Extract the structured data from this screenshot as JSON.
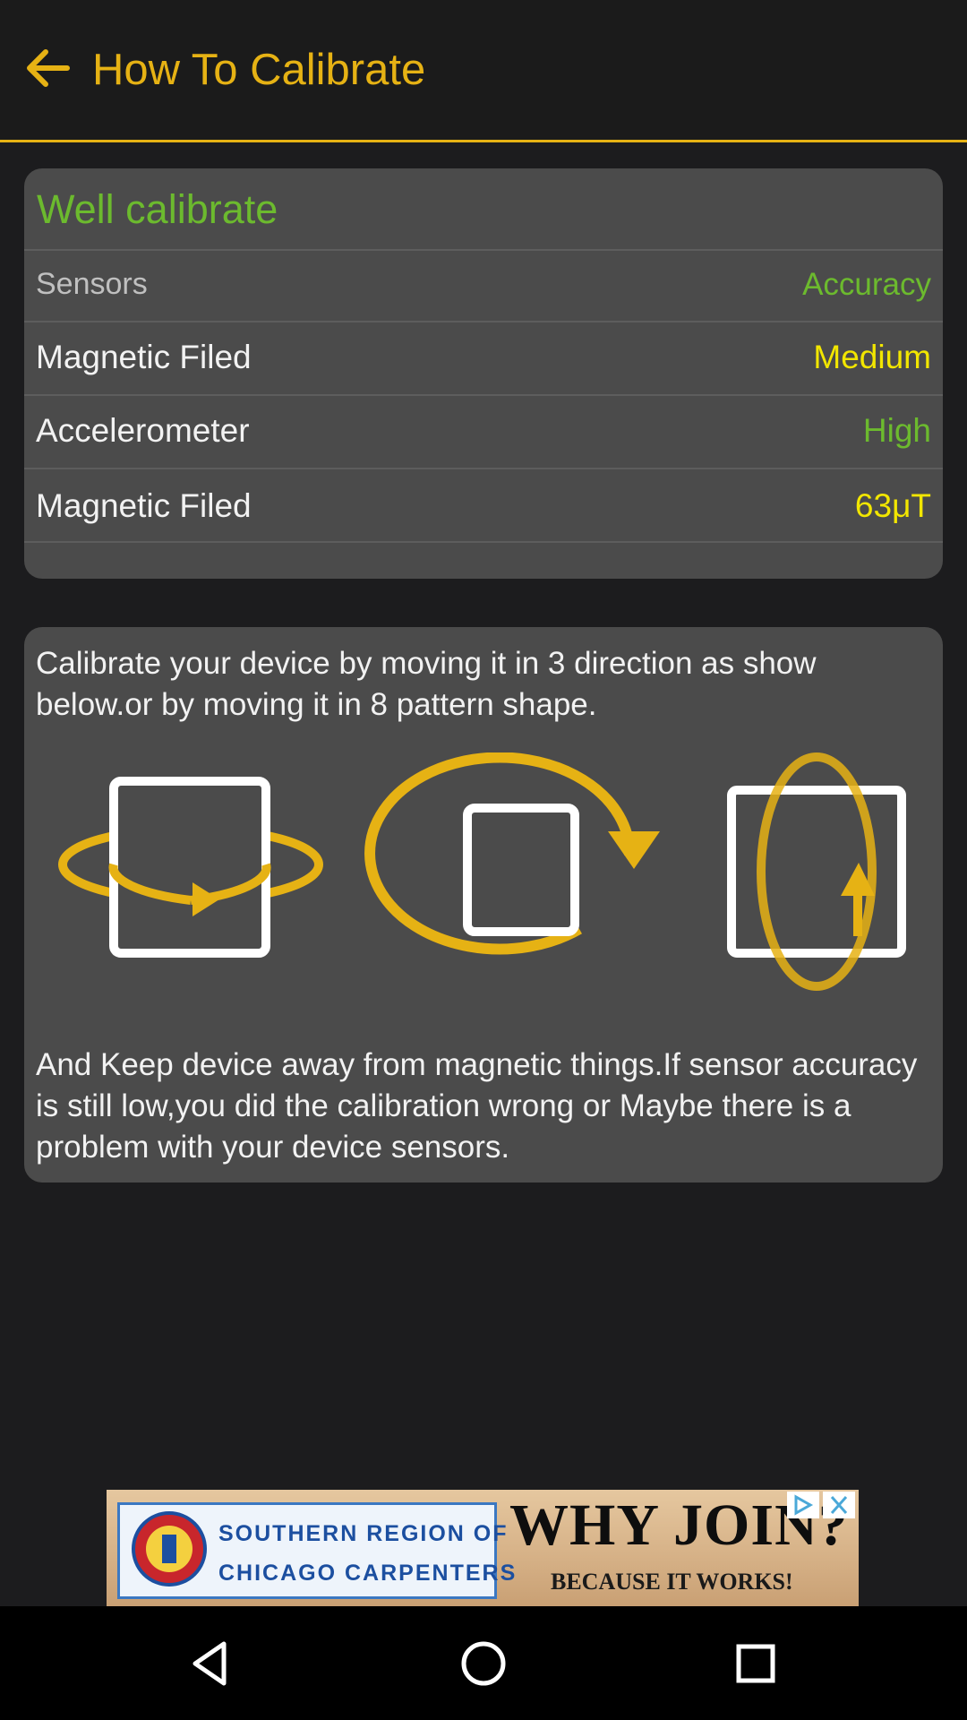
{
  "header": {
    "title": "How To Calibrate",
    "back_icon": "arrow-left-icon",
    "accent_color": "#e6b214"
  },
  "status_card": {
    "title": "Well calibrate",
    "columns": {
      "left": "Sensors",
      "right": "Accuracy"
    },
    "rows": [
      {
        "label": "Magnetic Filed",
        "value": "Medium",
        "value_color": "#f2e600"
      },
      {
        "label": "Accelerometer",
        "value": "High",
        "value_color": "#6cba2e"
      },
      {
        "label": "Magnetic Filed",
        "value": "63μT",
        "value_color": "#f2e600"
      }
    ]
  },
  "instructions_card": {
    "intro": "Calibrate your device by moving it in 3 direction as show below.or by moving it in 8 pattern shape.",
    "illustrations": [
      "rotate-horizontal-icon",
      "rotate-flat-icon",
      "rotate-vertical-icon"
    ],
    "note": "And Keep device away from magnetic things.If sensor accuracy is still low,you did the calibration wrong or Maybe there is a problem with your device sensors."
  },
  "ad_banner": {
    "org_line1": "SOUTHERN REGION OF",
    "org_line2": "CHICAGO CARPENTERS",
    "headline": "WHY JOIN?",
    "tagline": "BECAUSE IT WORKS!"
  },
  "nav_bar": {
    "icons": [
      "back-triangle-icon",
      "home-circle-icon",
      "recents-square-icon"
    ]
  }
}
